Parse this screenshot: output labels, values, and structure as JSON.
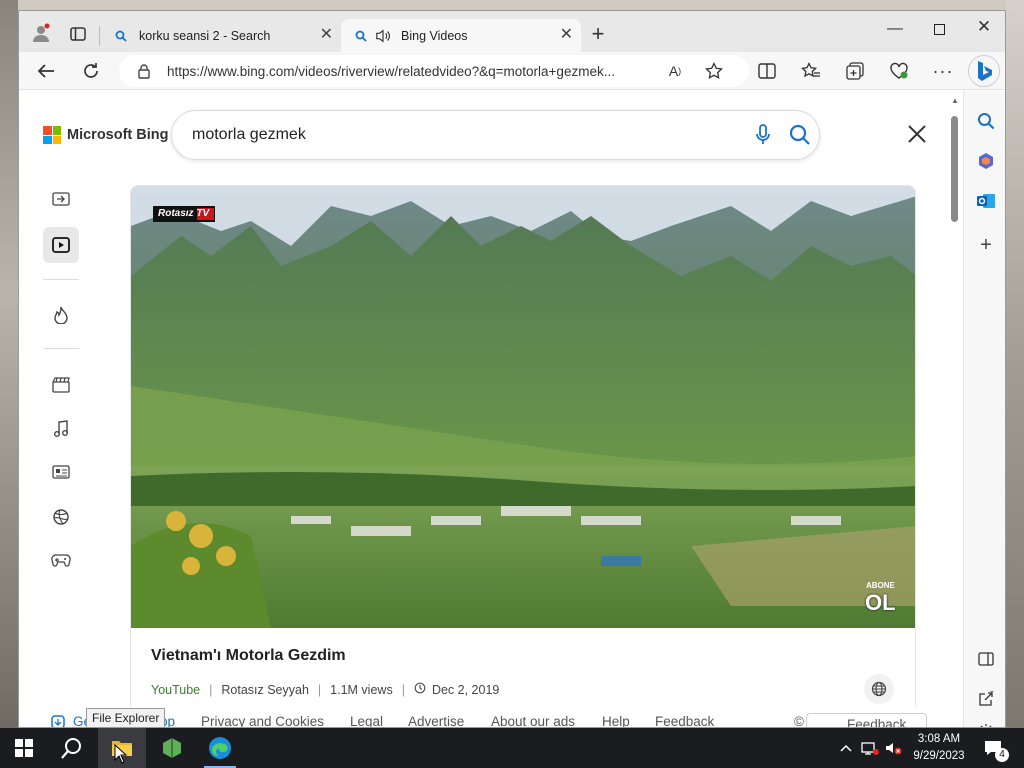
{
  "browser": {
    "tabs": [
      {
        "label": "korku seansi 2 - Search",
        "icon": "search-icon"
      },
      {
        "label": "Bing Videos",
        "icon": "speaker-icon",
        "active": true
      }
    ],
    "url": "https://www.bing.com/videos/riverview/relatedvideo?&q=motorla+gezmek..."
  },
  "page": {
    "brand": "Microsoft Bing",
    "search_query": "motorla gezmek",
    "video": {
      "title": "Vietnam'ı Motorla Gezdim",
      "source": "YouTube",
      "channel": "Rotasız Seyyah",
      "views": "1.1M views",
      "date": "Dec 2, 2019",
      "watermark_top": "Rotasız TV",
      "watermark_bottom_small": "ABONE",
      "watermark_bottom": "OL"
    },
    "footer": {
      "get_app": "Ge",
      "app_tail": "pp",
      "links": [
        "Privacy and Cookies",
        "Legal",
        "Advertise",
        "About our ads",
        "Help",
        "Feedback"
      ],
      "copyright": "©",
      "feedback_btn": "Feedback"
    }
  },
  "tooltip": "File Explorer",
  "taskbar": {
    "time": "3:08 AM",
    "date": "9/29/2023",
    "notifications": "4"
  },
  "colors": {
    "bing_accent": "#1a73c7",
    "source_green": "#3b7d31",
    "taskbar": "#1b1c1f"
  }
}
